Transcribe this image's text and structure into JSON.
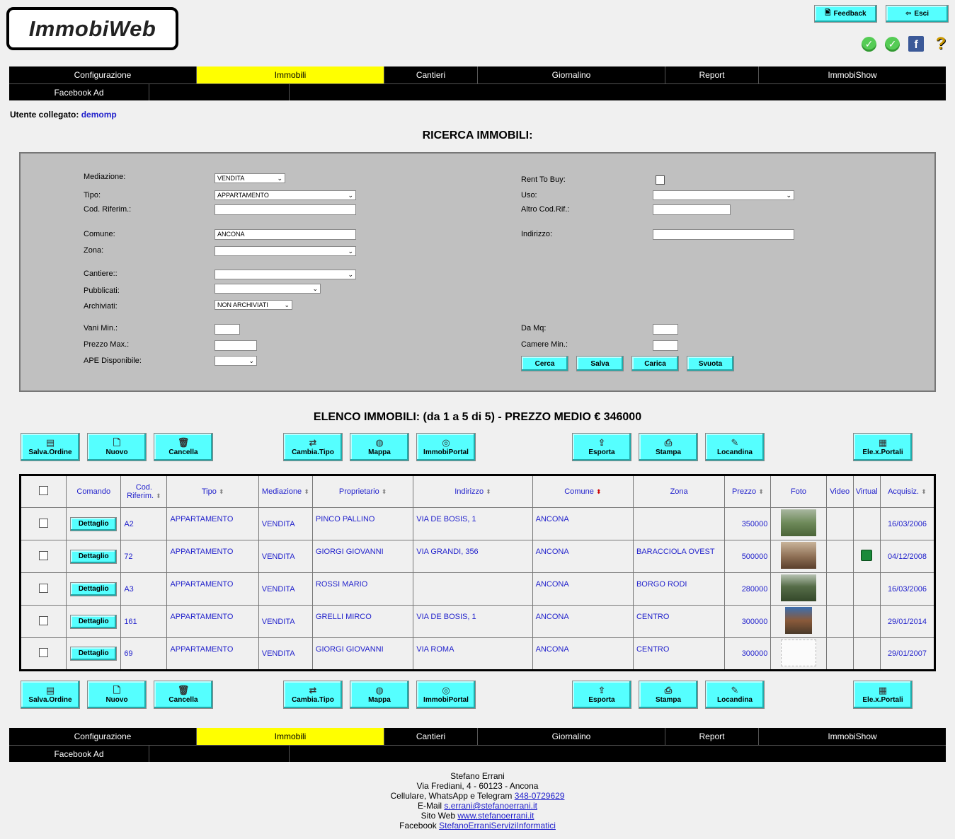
{
  "app": {
    "logo": "ImmobiWeb",
    "feedback_label": "Feedback",
    "logout_label": "Esci"
  },
  "nav": {
    "row1": [
      "Configurazione",
      "Immobili",
      "Cantieri",
      "Giornalino",
      "Report",
      "ImmobiShow"
    ],
    "row2": [
      "Facebook Ad",
      "",
      ""
    ],
    "active": "Immobili",
    "active_color": "#ffff00"
  },
  "user": {
    "prefix": "Utente collegato:",
    "name": "demomp"
  },
  "search": {
    "title": "RICERCA IMMOBILI:",
    "labels": {
      "mediazione": "Mediazione:",
      "tipo": "Tipo:",
      "cod_riferim": "Cod. Riferim.:",
      "comune": "Comune:",
      "zona": "Zona:",
      "cantiere": "Cantiere::",
      "pubblicati": "Pubblicati:",
      "archiviati": "Archiviati:",
      "vani_min": "Vani Min.:",
      "prezzo_max": "Prezzo Max.:",
      "ape": "APE Disponibile:",
      "rent_to_buy": "Rent To Buy:",
      "uso": "Uso:",
      "altro_cod": "Altro Cod.Rif.:",
      "indirizzo": "Indirizzo:",
      "da_mq": "Da Mq:",
      "camere_min": "Camere Min.:"
    },
    "values": {
      "mediazione": "VENDITA",
      "tipo": "APPARTAMENTO",
      "cod_riferim": "",
      "comune": "ANCONA",
      "zona": "",
      "cantiere": "",
      "pubblicati": "",
      "archiviati": "NON ARCHIVIATI",
      "vani_min": "",
      "prezzo_max": "",
      "ape": "",
      "uso": "",
      "altro_cod": "",
      "indirizzo": "",
      "da_mq": "",
      "camere_min": ""
    },
    "buttons": {
      "cerca": "Cerca",
      "salva": "Salva",
      "carica": "Carica",
      "svuota": "Svuota"
    }
  },
  "list": {
    "title": "ELENCO IMMOBILI: (da 1 a 5 di 5)  -  PREZZO MEDIO € 346000",
    "toolbar": {
      "salva_ordine": "Salva.Ordine",
      "nuovo": "Nuovo",
      "cancella": "Cancella",
      "cambia_tipo": "Cambia.Tipo",
      "mappa": "Mappa",
      "immobiportal": "ImmobiPortal",
      "esporta": "Esporta",
      "stampa": "Stampa",
      "locandina": "Locandina",
      "ele_portali": "Ele.x.Portali"
    },
    "columns": {
      "comando": "Comando",
      "cod_line1": "Cod.",
      "cod_line2": "Riferim.",
      "tipo": "Tipo",
      "mediazione": "Mediazione",
      "proprietario": "Proprietario",
      "indirizzo": "Indirizzo",
      "comune": "Comune",
      "zona": "Zona",
      "prezzo": "Prezzo",
      "foto": "Foto",
      "video": "Video",
      "virtual": "Virtual",
      "acquisiz": "Acquisiz."
    },
    "detail_label": "Dettaglio",
    "rows": [
      {
        "cod": "A2",
        "tipo": "APPARTAMENTO",
        "mediazione": "VENDITA",
        "proprietario": "PINCO PALLINO",
        "indirizzo": "VIA DE BOSIS, 1",
        "comune": "ANCONA",
        "zona": "",
        "prezzo": "350000",
        "virtual": false,
        "acquisiz": "16/03/2006"
      },
      {
        "cod": "72",
        "tipo": "APPARTAMENTO",
        "mediazione": "VENDITA",
        "proprietario": "GIORGI GIOVANNI",
        "indirizzo": "VIA GRANDI, 356",
        "comune": "ANCONA",
        "zona": "BARACCIOLA OVEST",
        "prezzo": "500000",
        "virtual": true,
        "acquisiz": "04/12/2008"
      },
      {
        "cod": "A3",
        "tipo": "APPARTAMENTO",
        "mediazione": "VENDITA",
        "proprietario": "ROSSI MARIO",
        "indirizzo": "",
        "comune": "ANCONA",
        "zona": "BORGO RODI",
        "prezzo": "280000",
        "virtual": false,
        "acquisiz": "16/03/2006"
      },
      {
        "cod": "161",
        "tipo": "APPARTAMENTO",
        "mediazione": "VENDITA",
        "proprietario": "GRELLI MIRCO",
        "indirizzo": "VIA DE BOSIS, 1",
        "comune": "ANCONA",
        "zona": "CENTRO",
        "prezzo": "300000",
        "virtual": false,
        "acquisiz": "29/01/2014"
      },
      {
        "cod": "69",
        "tipo": "APPARTAMENTO",
        "mediazione": "VENDITA",
        "proprietario": "GIORGI GIOVANNI",
        "indirizzo": "VIA ROMA",
        "comune": "ANCONA",
        "zona": "CENTRO",
        "prezzo": "300000",
        "virtual": false,
        "acquisiz": "29/01/2007"
      }
    ]
  },
  "footer": {
    "name": "Stefano Errani",
    "address": "Via Frediani, 4 - 60123 - Ancona",
    "phone_prefix": "Cellulare, WhatsApp e Telegram",
    "phone": "348-0729629",
    "email_prefix": "E-Mail",
    "email": "s.errani@stefanoerrani.it",
    "web_prefix": "Sito Web",
    "web": "www.stefanoerrani.it",
    "fb_prefix": "Facebook",
    "fb": "StefanoErraniServiziInformatici"
  }
}
